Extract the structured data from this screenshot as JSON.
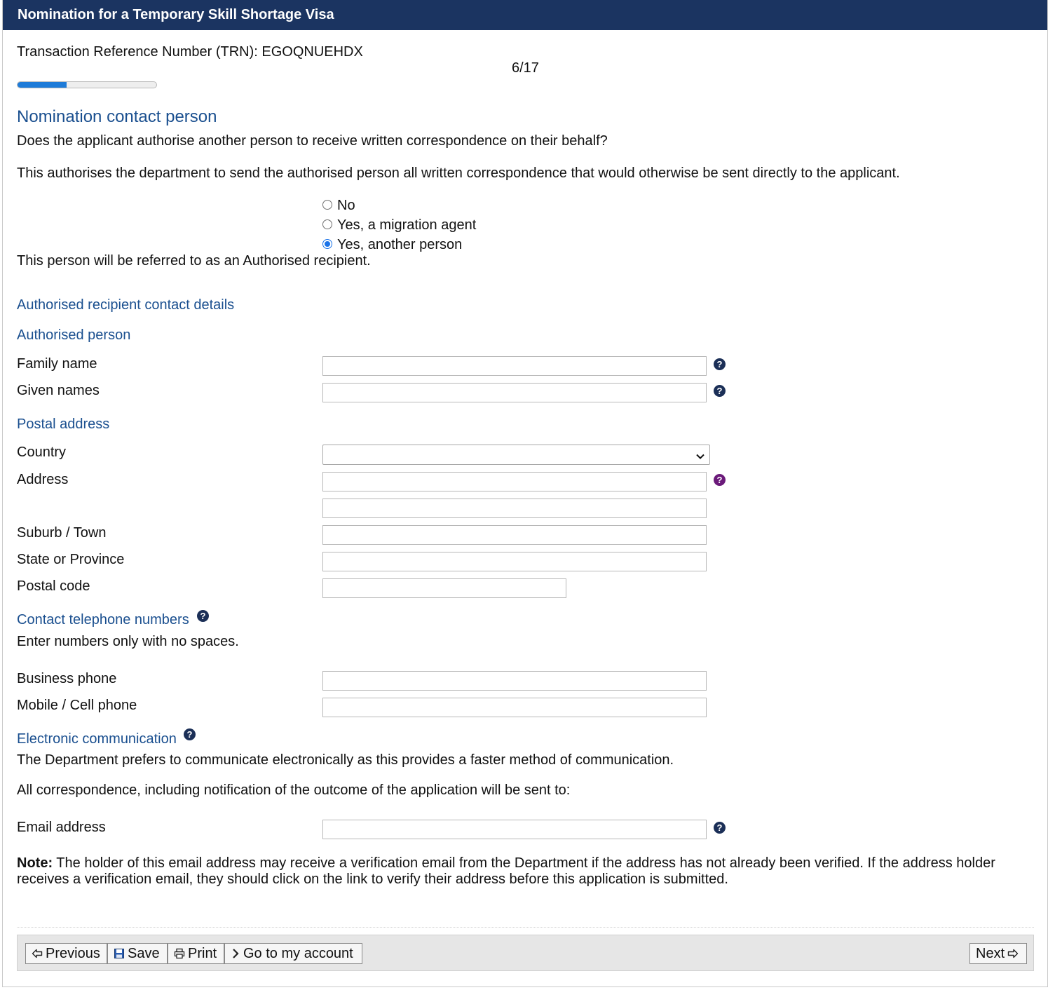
{
  "header": {
    "title": "Nomination for a Temporary Skill Shortage Visa"
  },
  "trn": {
    "label": "Transaction Reference Number (TRN):",
    "value": "EGOQNUEHDX"
  },
  "progress": {
    "label": "6/17",
    "current": 6,
    "total": 17
  },
  "contact": {
    "heading": "Nomination contact person",
    "question": "Does the applicant authorise another person to receive written correspondence on their behalf?",
    "explanation": "This authorises the department to send the authorised person all written correspondence that would otherwise be sent directly to the applicant.",
    "options": [
      "No",
      "Yes, a migration agent",
      "Yes, another person"
    ],
    "selected": "Yes, another person",
    "referred_note": "This person will be referred to as an Authorised recipient."
  },
  "recipient": {
    "heading": "Authorised recipient contact details",
    "person_heading": "Authorised person",
    "family_name_label": "Family name",
    "family_name_value": "",
    "given_names_label": "Given names",
    "given_names_value": ""
  },
  "postal": {
    "heading": "Postal address",
    "country_label": "Country",
    "country_value": "",
    "address_label": "Address",
    "address_line1": "",
    "address_line2": "",
    "suburb_label": "Suburb / Town",
    "suburb_value": "",
    "state_label": "State or Province",
    "state_value": "",
    "postcode_label": "Postal code",
    "postcode_value": ""
  },
  "phones": {
    "heading": "Contact telephone numbers",
    "hint": "Enter numbers only with no spaces.",
    "business_label": "Business phone",
    "business_value": "",
    "mobile_label": "Mobile / Cell phone",
    "mobile_value": ""
  },
  "electronic": {
    "heading": "Electronic communication",
    "prefers": "The Department prefers to communicate electronically as this provides a faster method of communication.",
    "all_corr": "All correspondence, including notification of the outcome of the application will be sent to:",
    "email_label": "Email address",
    "email_value": "",
    "note_label": "Note:",
    "note_text": " The holder of this email address may receive a verification email from the Department if the address has not already been verified. If the address holder receives a verification email, they should click on the link to verify their address before this application is submitted."
  },
  "footer": {
    "previous": "Previous",
    "save": "Save",
    "print": "Print",
    "account": "Go to my account",
    "next": "Next"
  },
  "icons": {
    "help": "question-circle-icon",
    "previous": "arrow-left-icon",
    "save": "floppy-disk-icon",
    "print": "printer-icon",
    "account": "chevron-right-icon",
    "next": "arrow-right-icon"
  },
  "colors": {
    "header_bg": "#1b3461",
    "section_heading": "#1a4f8f",
    "progress_fill": "#1e7bd8",
    "help_icon": "#1b2f57",
    "help_icon_visited": "#6b1a7a"
  }
}
